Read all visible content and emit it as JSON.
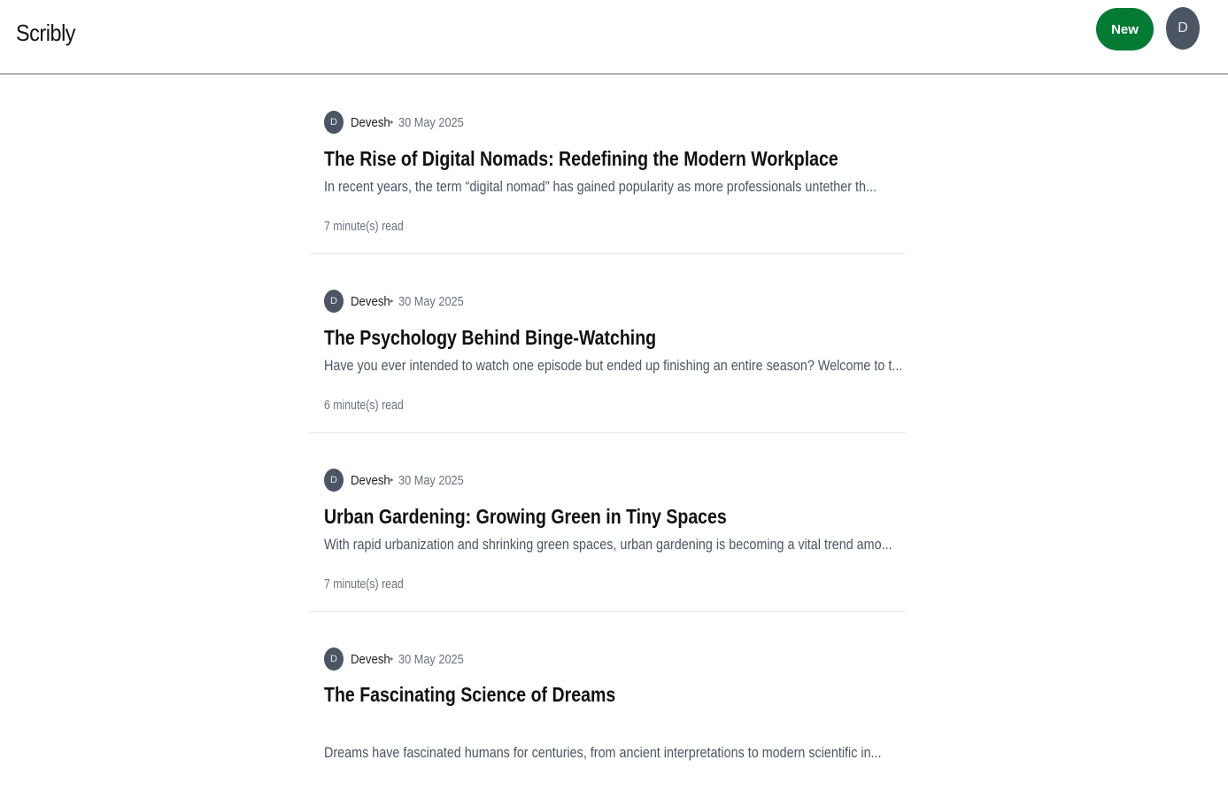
{
  "header": {
    "brand": "Scribly",
    "new_label": "New",
    "avatar_initial": "D"
  },
  "posts": [
    {
      "avatar_initial": "D",
      "author": "Devesh",
      "separator": "•",
      "date": "30 May 2025",
      "title": "The Rise of Digital Nomads: Redefining the Modern Workplace",
      "excerpt": "In recent years, the term “digital nomad” has gained popularity as more professionals untether th...",
      "read_time": "7 minute(s) read"
    },
    {
      "avatar_initial": "D",
      "author": "Devesh",
      "separator": "•",
      "date": "30 May 2025",
      "title": "The Psychology Behind Binge-Watching",
      "excerpt": "Have you ever intended to watch one episode but ended up finishing an entire season? Welcome to t...",
      "read_time": "6 minute(s) read"
    },
    {
      "avatar_initial": "D",
      "author": "Devesh",
      "separator": "•",
      "date": "30 May 2025",
      "title": "Urban Gardening: Growing Green in Tiny Spaces",
      "excerpt": "With rapid urbanization and shrinking green spaces, urban gardening is becoming a vital trend amo...",
      "read_time": "7 minute(s) read"
    },
    {
      "avatar_initial": "D",
      "author": "Devesh",
      "separator": "•",
      "date": "30 May 2025",
      "title": "The Fascinating Science of Dreams",
      "excerpt": "Dreams have fascinated humans for centuries, from ancient interpretations to modern scientific in..."
    }
  ],
  "colors": {
    "new_button": "#047a35",
    "avatar": "#4b5563"
  }
}
